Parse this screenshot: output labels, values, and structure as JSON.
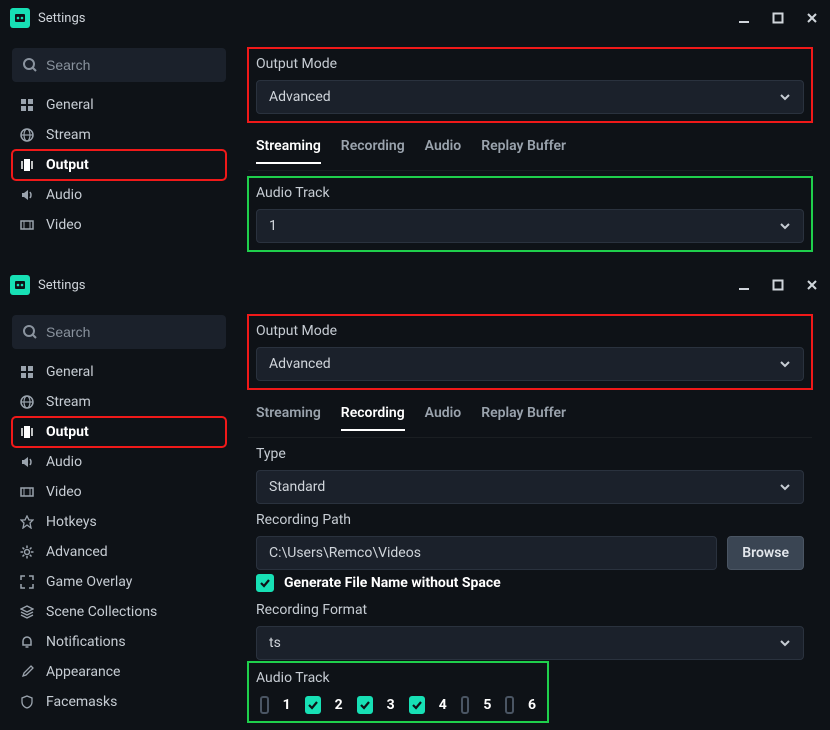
{
  "window1": {
    "title": "Settings",
    "search_placeholder": "Search",
    "sidebar": [
      {
        "label": "General"
      },
      {
        "label": "Stream"
      },
      {
        "label": "Output",
        "active": true
      },
      {
        "label": "Audio"
      },
      {
        "label": "Video"
      }
    ],
    "output_mode_label": "Output Mode",
    "output_mode_value": "Advanced",
    "tabs": [
      "Streaming",
      "Recording",
      "Audio",
      "Replay Buffer"
    ],
    "active_tab": "Streaming",
    "audio_track_label": "Audio Track",
    "audio_track_value": "1"
  },
  "window2": {
    "title": "Settings",
    "search_placeholder": "Search",
    "sidebar": [
      {
        "label": "General"
      },
      {
        "label": "Stream"
      },
      {
        "label": "Output",
        "active": true
      },
      {
        "label": "Audio"
      },
      {
        "label": "Video"
      },
      {
        "label": "Hotkeys"
      },
      {
        "label": "Advanced"
      },
      {
        "label": "Game Overlay"
      },
      {
        "label": "Scene Collections"
      },
      {
        "label": "Notifications"
      },
      {
        "label": "Appearance"
      },
      {
        "label": "Facemasks"
      }
    ],
    "output_mode_label": "Output Mode",
    "output_mode_value": "Advanced",
    "tabs": [
      "Streaming",
      "Recording",
      "Audio",
      "Replay Buffer"
    ],
    "active_tab": "Recording",
    "type_label": "Type",
    "type_value": "Standard",
    "recording_path_label": "Recording Path",
    "recording_path_value": "C:\\Users\\Remco\\Videos",
    "browse_label": "Browse",
    "gen_filename_label": "Generate File Name without Space",
    "gen_filename_checked": true,
    "recording_format_label": "Recording Format",
    "recording_format_value": "ts",
    "audio_track_label": "Audio Track",
    "audio_tracks": [
      {
        "n": "1",
        "checked": false
      },
      {
        "n": "2",
        "checked": true
      },
      {
        "n": "3",
        "checked": true
      },
      {
        "n": "4",
        "checked": true
      },
      {
        "n": "5",
        "checked": false
      },
      {
        "n": "6",
        "checked": false
      }
    ]
  }
}
